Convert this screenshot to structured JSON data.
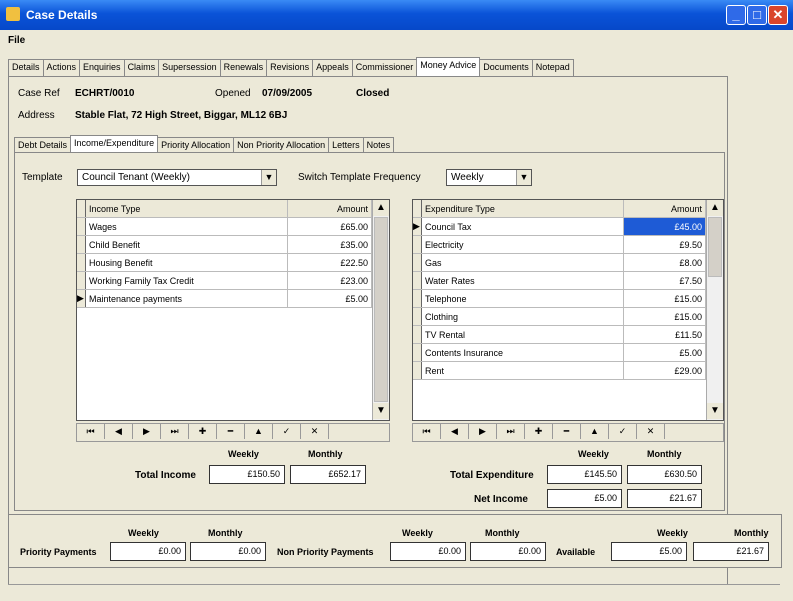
{
  "window": {
    "title": "Case Details"
  },
  "menu": {
    "file": "File"
  },
  "main_tabs": [
    "Details",
    "Actions",
    "Enquiries",
    "Claims",
    "Supersession",
    "Renewals",
    "Revisions",
    "Appeals",
    "Commissioner",
    "Money Advice",
    "Documents",
    "Notepad"
  ],
  "case": {
    "ref_label": "Case Ref",
    "ref_value": "ECHRT/0010",
    "opened_label": "Opened",
    "opened_value": "07/09/2005",
    "closed_label": "Closed",
    "address_label": "Address",
    "address_value": "Stable Flat, 72 High Street, Biggar, ML12 6BJ"
  },
  "sub_tabs": [
    "Debt Details",
    "Income/Expenditure",
    "Priority Allocation",
    "Non Priority Allocation",
    "Letters",
    "Notes"
  ],
  "template": {
    "label": "Template",
    "value": "Council Tenant (Weekly)",
    "freq_label": "Switch Template Frequency",
    "freq_value": "Weekly"
  },
  "income": {
    "col_type": "Income Type",
    "col_amount": "Amount",
    "rows": [
      {
        "type": "Wages",
        "amount": "£65.00"
      },
      {
        "type": "Child Benefit",
        "amount": "£35.00"
      },
      {
        "type": "Housing Benefit",
        "amount": "£22.50"
      },
      {
        "type": "Working Family Tax Credit",
        "amount": "£23.00"
      },
      {
        "type": "Maintenance payments",
        "amount": "£5.00"
      }
    ]
  },
  "expenditure": {
    "col_type": "Expenditure Type",
    "col_amount": "Amount",
    "rows": [
      {
        "type": "Council Tax",
        "amount": "£45.00"
      },
      {
        "type": "Electricity",
        "amount": "£9.50"
      },
      {
        "type": "Gas",
        "amount": "£8.00"
      },
      {
        "type": "Water Rates",
        "amount": "£7.50"
      },
      {
        "type": "Telephone",
        "amount": "£15.00"
      },
      {
        "type": "Clothing",
        "amount": "£15.00"
      },
      {
        "type": "TV Rental",
        "amount": "£11.50"
      },
      {
        "type": "Contents Insurance",
        "amount": "£5.00"
      },
      {
        "type": "Rent",
        "amount": "£29.00"
      }
    ]
  },
  "totals": {
    "weekly_label": "Weekly",
    "monthly_label": "Monthly",
    "total_income_label": "Total Income",
    "total_income_weekly": "£150.50",
    "total_income_monthly": "£652.17",
    "total_expenditure_label": "Total Expenditure",
    "total_expenditure_weekly": "£145.50",
    "total_expenditure_monthly": "£630.50",
    "net_income_label": "Net Income",
    "net_income_weekly": "£5.00",
    "net_income_monthly": "£21.67"
  },
  "payments": {
    "weekly_label": "Weekly",
    "monthly_label": "Monthly",
    "priority_label": "Priority Payments",
    "priority_weekly": "£0.00",
    "priority_monthly": "£0.00",
    "non_priority_label": "Non Priority Payments",
    "non_priority_weekly": "£0.00",
    "non_priority_monthly": "£0.00",
    "available_label": "Available",
    "available_weekly": "£5.00",
    "available_monthly": "£21.67"
  },
  "icons": {
    "app": "app-icon",
    "minimize": "minimize-icon",
    "maximize": "maximize-icon",
    "close": "close-icon",
    "nav": [
      "first-record-icon",
      "prev-page-icon",
      "next-page-icon",
      "last-record-icon",
      "add-record-icon",
      "delete-record-icon",
      "edit-record-icon",
      "save-record-icon",
      "cancel-record-icon"
    ]
  },
  "colors": {
    "title_bar": "#0a53d8",
    "selection": "#1e5bd6",
    "window_bg": "#ece9d8"
  }
}
